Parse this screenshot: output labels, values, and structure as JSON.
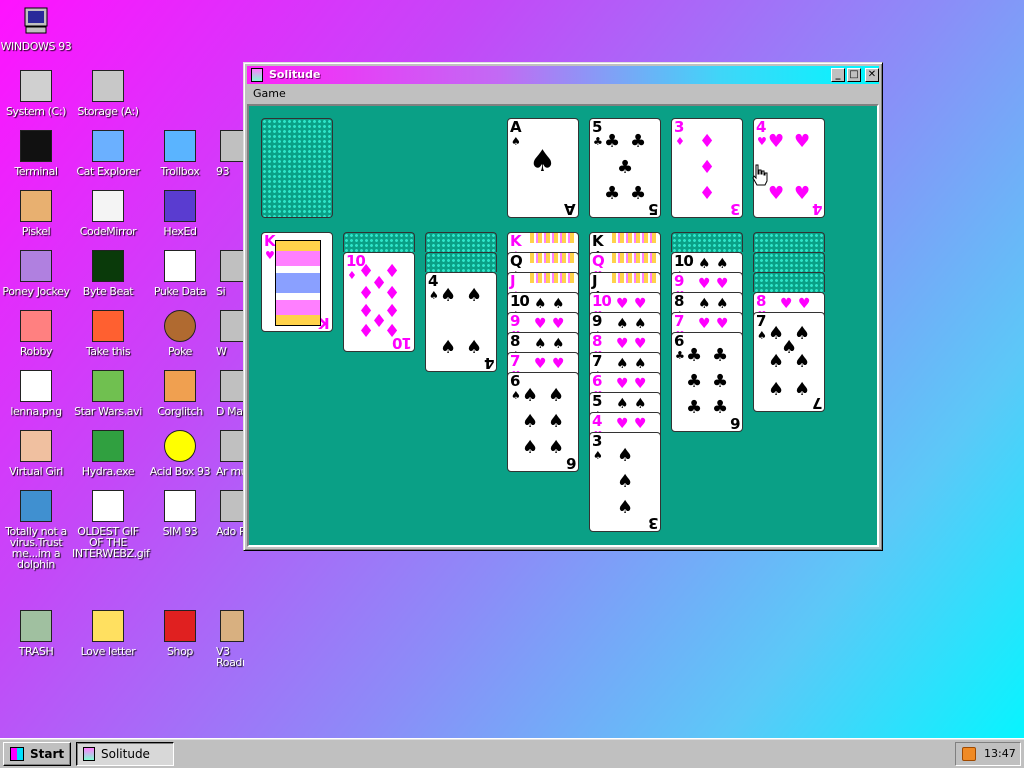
{
  "os_logo_label": "WINDOWS 93",
  "desktop_icons": [
    {
      "label": "System (C:)",
      "icon": "hard-drive-icon"
    },
    {
      "label": "Storage (A:)",
      "icon": "floppy-drive-icon"
    },
    {
      "label": "Terminal",
      "icon": "terminal-icon"
    },
    {
      "label": "Cat Explorer",
      "icon": "cat-explorer-icon"
    },
    {
      "label": "Trollbox",
      "icon": "trollbox-icon"
    },
    {
      "label": "93",
      "icon": "partial-icon"
    },
    {
      "label": "Piskel",
      "icon": "palette-icon"
    },
    {
      "label": "CodeMirror",
      "icon": "codemirror-icon"
    },
    {
      "label": "HexEd",
      "icon": "hexed-cube-icon"
    },
    {
      "label": "Poney Jockey",
      "icon": "pony-icon"
    },
    {
      "label": "Byte Beat",
      "icon": "byte-beat-icon"
    },
    {
      "label": "Puke Data",
      "icon": "puke-data-icon"
    },
    {
      "label": "Si",
      "icon": "partial-icon"
    },
    {
      "label": "Robby",
      "icon": "robby-icon"
    },
    {
      "label": "Take this",
      "icon": "take-this-icon"
    },
    {
      "label": "Poke",
      "icon": "pokeball-icon"
    },
    {
      "label": "W",
      "icon": "partial-icon"
    },
    {
      "label": "lenna.png",
      "icon": "image-file-icon"
    },
    {
      "label": "Star Wars.avi",
      "icon": "yoda-icon"
    },
    {
      "label": "Corglitch",
      "icon": "corgi-icon"
    },
    {
      "label": "D Ma",
      "icon": "partial-icon"
    },
    {
      "label": "Virtual Girl",
      "icon": "virtual-girl-icon"
    },
    {
      "label": "Hydra.exe",
      "icon": "hydra-icon"
    },
    {
      "label": "Acid Box 93",
      "icon": "smiley-icon"
    },
    {
      "label": "Ar mult",
      "icon": "partial-icon"
    },
    {
      "label": "Totally not a virus.Trust me...im a dolphin",
      "icon": "dolphin-icon"
    },
    {
      "label": "OLDEST GIF OF THE INTERWEBZ.gif",
      "icon": "gif-file-icon"
    },
    {
      "label": "SIM 93",
      "icon": "sim-icon"
    },
    {
      "label": "Ado Pla",
      "icon": "partial-icon"
    },
    {
      "label": "TRASH",
      "icon": "trash-icon"
    },
    {
      "label": "Love letter",
      "icon": "envelope-icon"
    },
    {
      "label": "Shop",
      "icon": "gift-icon"
    },
    {
      "label": "V3 Roadmap",
      "icon": "map-icon"
    }
  ],
  "window": {
    "title": "Solitude",
    "minimize": "_",
    "maximize": "□",
    "close": "✕",
    "menu": [
      "Game"
    ]
  },
  "foundations": [
    {
      "rank": "A",
      "suit": "♠",
      "color": "black"
    },
    {
      "rank": "5",
      "suit": "♣",
      "color": "black"
    },
    {
      "rank": "3",
      "suit": "♦",
      "color": "red"
    },
    {
      "rank": "4",
      "suit": "♥",
      "color": "red"
    }
  ],
  "tableau": [
    {
      "hidden": 0,
      "cards": [
        {
          "rank": "K",
          "suit": "♥",
          "color": "red"
        }
      ]
    },
    {
      "hidden": 1,
      "cards": [
        {
          "rank": "10",
          "suit": "♦",
          "color": "red"
        }
      ]
    },
    {
      "hidden": 2,
      "cards": [
        {
          "rank": "4",
          "suit": "♠",
          "color": "black"
        }
      ]
    },
    {
      "hidden": 0,
      "cards": [
        {
          "rank": "K",
          "suit": "♦",
          "color": "red"
        },
        {
          "rank": "Q",
          "suit": "♠",
          "color": "black"
        },
        {
          "rank": "J",
          "suit": "♦",
          "color": "red"
        },
        {
          "rank": "10",
          "suit": "♠",
          "color": "black"
        },
        {
          "rank": "9",
          "suit": "♥",
          "color": "red"
        },
        {
          "rank": "8",
          "suit": "♠",
          "color": "black"
        },
        {
          "rank": "7",
          "suit": "♥",
          "color": "red"
        },
        {
          "rank": "6",
          "suit": "♠",
          "color": "black"
        }
      ]
    },
    {
      "hidden": 0,
      "cards": [
        {
          "rank": "K",
          "suit": "♣",
          "color": "black"
        },
        {
          "rank": "Q",
          "suit": "♥",
          "color": "red"
        },
        {
          "rank": "J",
          "suit": "♣",
          "color": "black"
        },
        {
          "rank": "10",
          "suit": "♥",
          "color": "red"
        },
        {
          "rank": "9",
          "suit": "♠",
          "color": "black"
        },
        {
          "rank": "8",
          "suit": "♥",
          "color": "red"
        },
        {
          "rank": "7",
          "suit": "♠",
          "color": "black"
        },
        {
          "rank": "6",
          "suit": "♥",
          "color": "red"
        },
        {
          "rank": "5",
          "suit": "♠",
          "color": "black"
        },
        {
          "rank": "4",
          "suit": "♥",
          "color": "red"
        },
        {
          "rank": "3",
          "suit": "♠",
          "color": "black"
        }
      ]
    },
    {
      "hidden": 1,
      "cards": [
        {
          "rank": "10",
          "suit": "♠",
          "color": "black"
        },
        {
          "rank": "9",
          "suit": "♥",
          "color": "red"
        },
        {
          "rank": "8",
          "suit": "♠",
          "color": "black"
        },
        {
          "rank": "7",
          "suit": "♥",
          "color": "red"
        },
        {
          "rank": "6",
          "suit": "♣",
          "color": "black"
        }
      ]
    },
    {
      "hidden": 3,
      "cards": [
        {
          "rank": "8",
          "suit": "♥",
          "color": "red"
        },
        {
          "rank": "7",
          "suit": "♠",
          "color": "black"
        }
      ]
    }
  ],
  "taskbar": {
    "start_label": "Start",
    "task_label": "Solitude",
    "clock": "13:47"
  },
  "colors": {
    "red_suit": "#ff00ff",
    "felt": "#0aa086",
    "titlebar_start": "#fe22f8",
    "titlebar_end": "#00f8ff"
  }
}
